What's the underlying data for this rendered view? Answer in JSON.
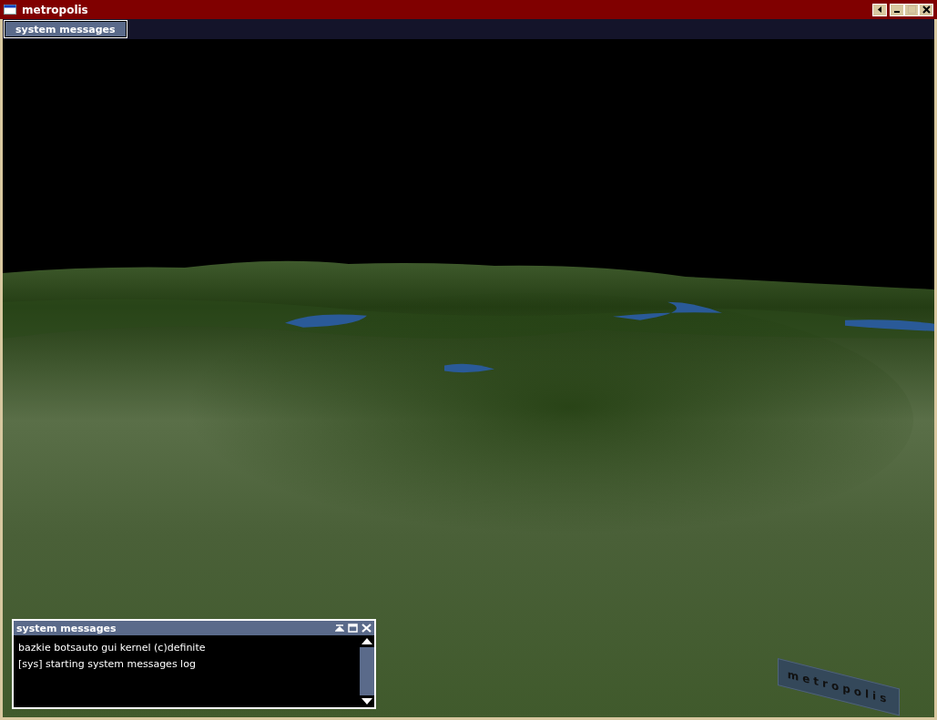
{
  "window": {
    "title": "metropolis"
  },
  "tabs": [
    {
      "label": "system messages",
      "selected": true
    }
  ],
  "scene": {
    "sign": "metropolis"
  },
  "messages_window": {
    "title": "system messages",
    "lines": [
      "bazkie botsauto gui kernel (c)definite",
      "[sys] starting system messages log"
    ]
  }
}
